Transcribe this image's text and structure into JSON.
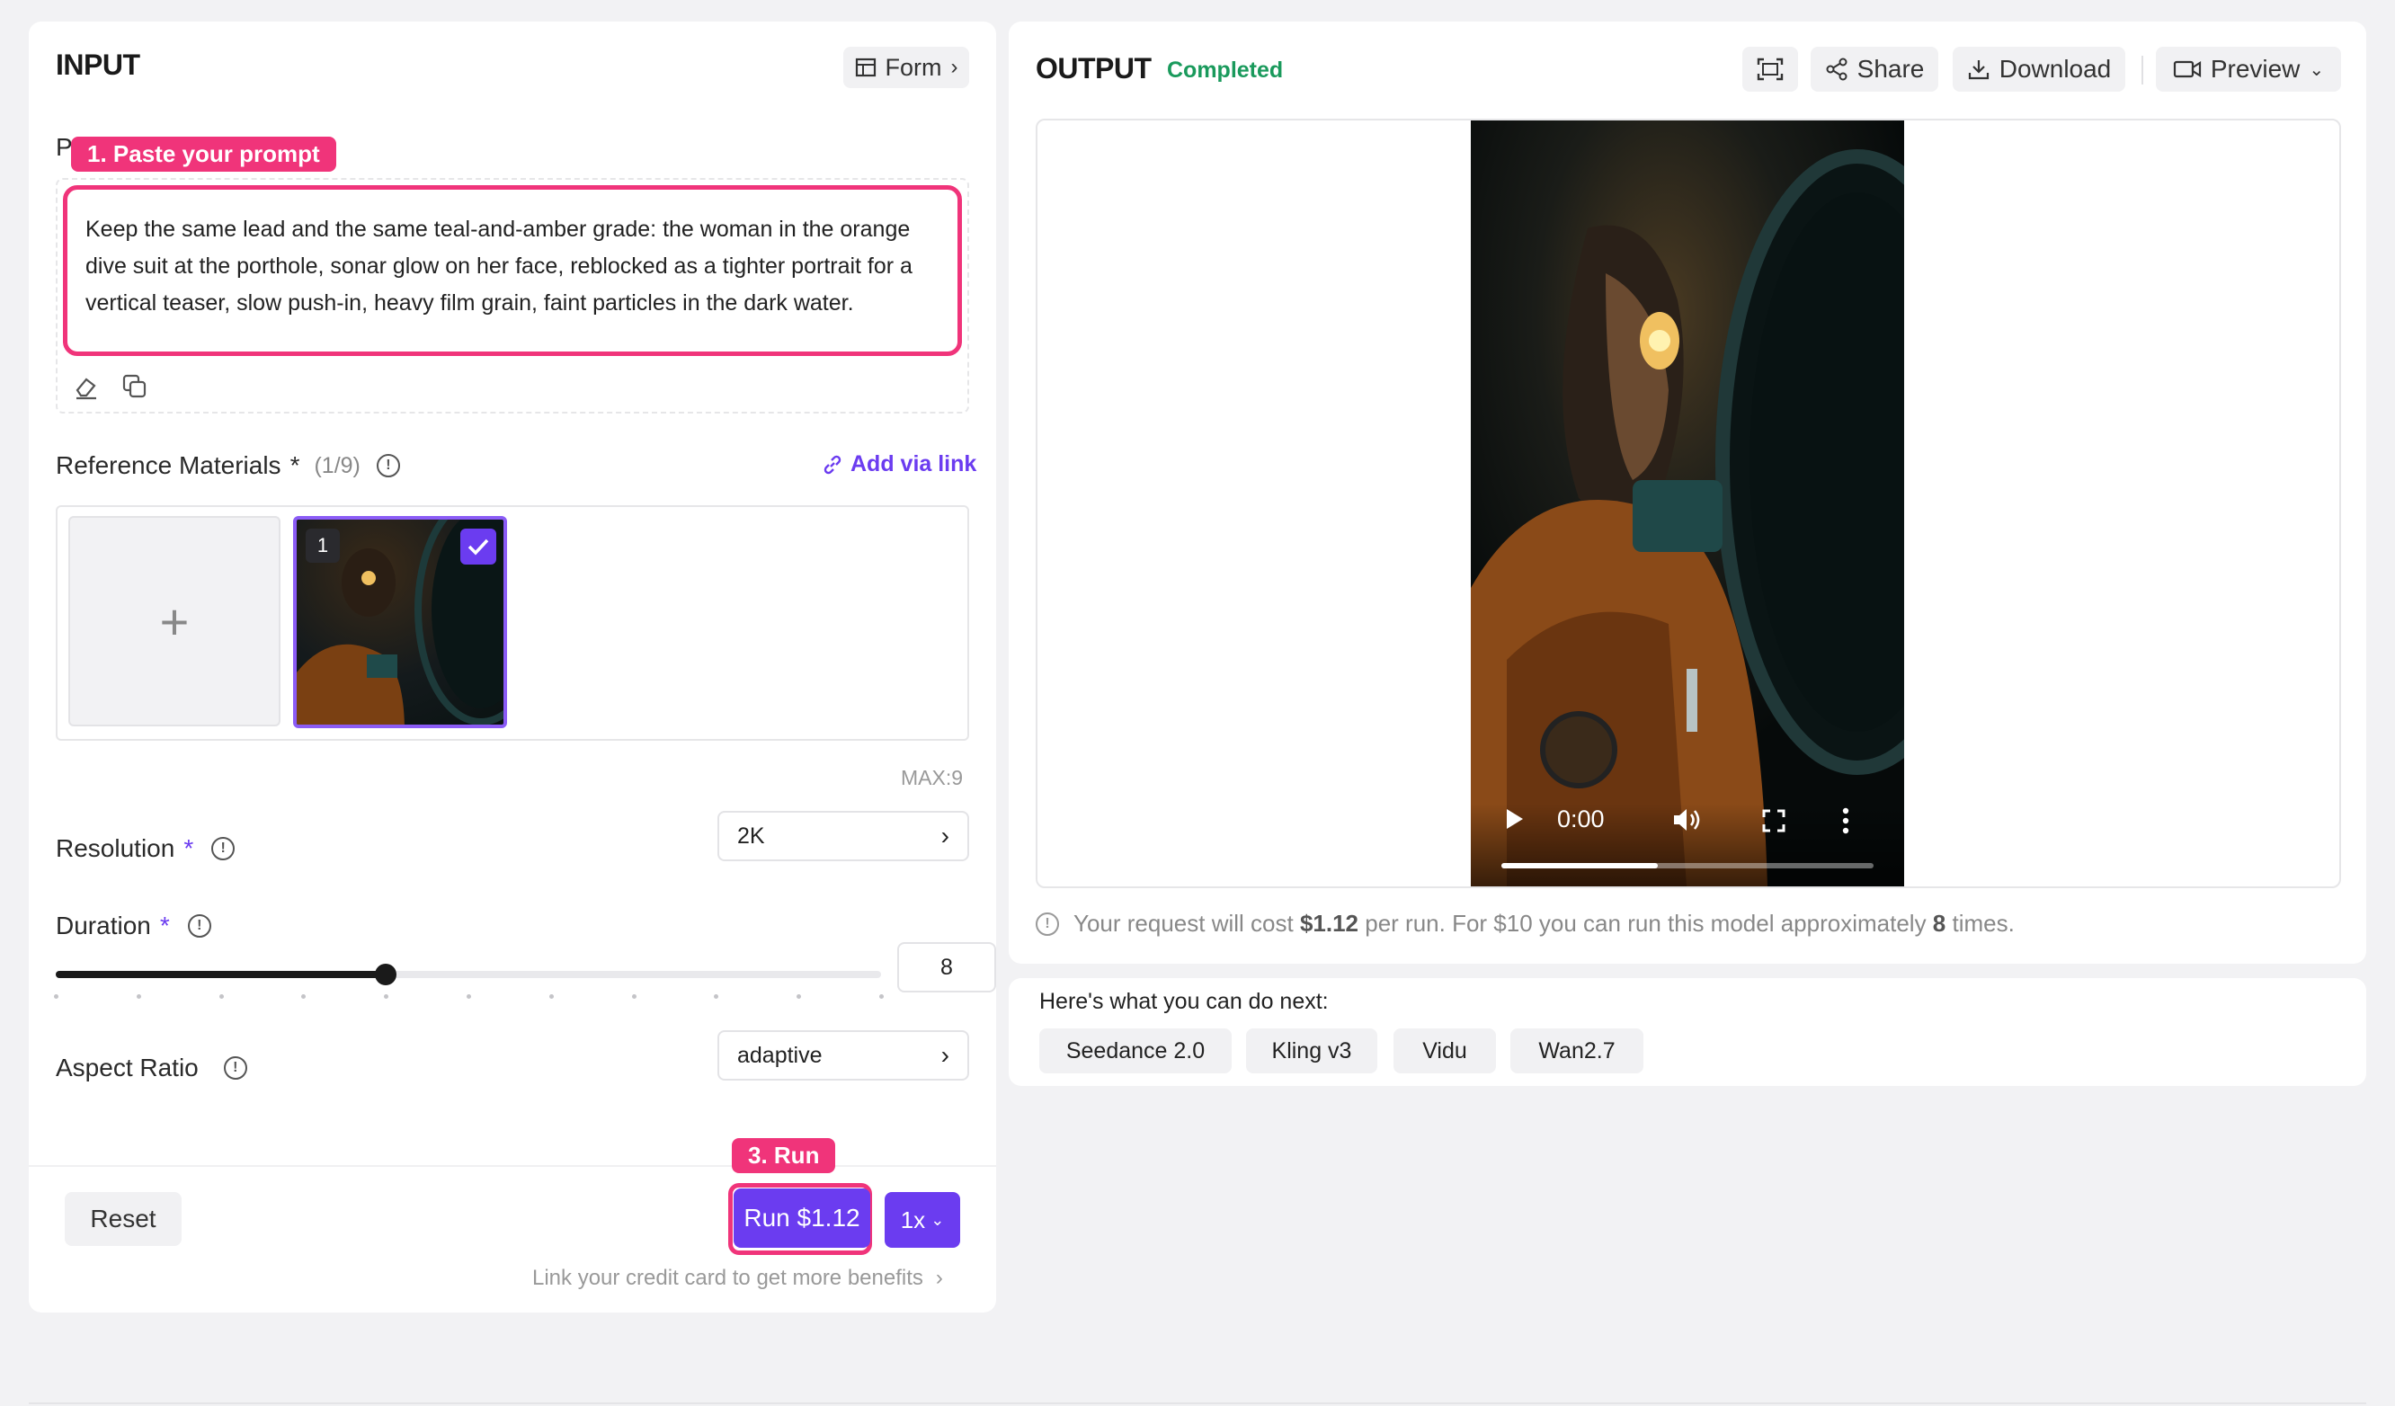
{
  "input": {
    "title": "INPUT",
    "form_label": "Form",
    "prompt_label_partial": "P",
    "prompt_tag": "1. Paste your prompt",
    "prompt_text": "Keep the same lead and the same teal-and-amber grade: the woman in the orange dive suit at the porthole, sonar glow on her face, reblocked as a tighter portrait for a vertical teaser, slow push-in, heavy film grain, faint particles in the dark water.",
    "reference_label": "Reference Materials",
    "required_mark": "*",
    "reference_count": "(1/9)",
    "add_via_link": "Add via link",
    "add_plus": "+",
    "thumb_index": "1",
    "max_label": "MAX:9",
    "resolution_label": "Resolution",
    "resolution_value": "2K",
    "duration_label": "Duration",
    "duration_value": "8",
    "duration_fraction": 0.4,
    "aspect_label": "Aspect Ratio",
    "aspect_value": "adaptive",
    "run_tag": "3. Run",
    "reset_label": "Reset",
    "run_label": "Run $1.12",
    "multiplier": "1x",
    "credit_link": "Link your credit card to get more benefits"
  },
  "output": {
    "title": "OUTPUT",
    "status": "Completed",
    "share_label": "Share",
    "download_label": "Download",
    "preview_label": "Preview",
    "time": "0:00",
    "progress_fraction": 0.42,
    "cost_prefix": "Your request will cost ",
    "cost_amount": "$1.12",
    "cost_mid": " per run. For $10 you can run this model approximately ",
    "cost_times": "8",
    "cost_suffix": " times."
  },
  "next": {
    "title": "Here's what you can do next:",
    "models": [
      "Seedance 2.0",
      "Kling v3",
      "Vidu",
      "Wan2.7"
    ]
  },
  "colors": {
    "accent_purple": "#6b3cf0",
    "highlight_pink": "#f0347a",
    "status_green": "#1a9a5c"
  }
}
